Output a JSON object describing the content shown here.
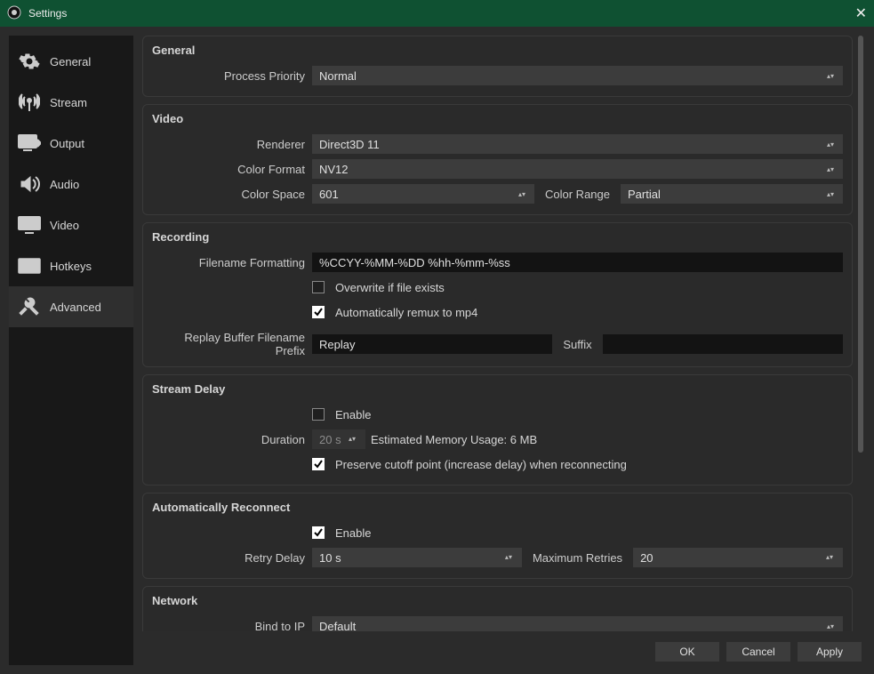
{
  "window": {
    "title": "Settings",
    "close": "✕"
  },
  "sidebar": {
    "items": [
      {
        "label": "General"
      },
      {
        "label": "Stream"
      },
      {
        "label": "Output"
      },
      {
        "label": "Audio"
      },
      {
        "label": "Video"
      },
      {
        "label": "Hotkeys"
      },
      {
        "label": "Advanced"
      }
    ]
  },
  "groups": {
    "general": {
      "title": "General",
      "process_priority_label": "Process Priority",
      "process_priority_value": "Normal"
    },
    "video": {
      "title": "Video",
      "renderer_label": "Renderer",
      "renderer_value": "Direct3D 11",
      "color_format_label": "Color Format",
      "color_format_value": "NV12",
      "color_space_label": "Color Space",
      "color_space_value": "601",
      "color_range_label": "Color Range",
      "color_range_value": "Partial"
    },
    "recording": {
      "title": "Recording",
      "filename_fmt_label": "Filename Formatting",
      "filename_fmt_value": "%CCYY-%MM-%DD %hh-%mm-%ss",
      "overwrite_label": "Overwrite if file exists",
      "overwrite_checked": false,
      "remux_label": "Automatically remux to mp4",
      "remux_checked": true,
      "replay_prefix_label": "Replay Buffer Filename Prefix",
      "replay_prefix_value": "Replay",
      "suffix_label": "Suffix",
      "suffix_value": ""
    },
    "stream_delay": {
      "title": "Stream Delay",
      "enable_label": "Enable",
      "enable_checked": false,
      "duration_label": "Duration",
      "duration_value": "20 s",
      "memory_usage": "Estimated Memory Usage: 6 MB",
      "preserve_label": "Preserve cutoff point (increase delay) when reconnecting",
      "preserve_checked": true
    },
    "reconnect": {
      "title": "Automatically Reconnect",
      "enable_label": "Enable",
      "enable_checked": true,
      "retry_delay_label": "Retry Delay",
      "retry_delay_value": "10 s",
      "max_retries_label": "Maximum Retries",
      "max_retries_value": "20"
    },
    "network": {
      "title": "Network",
      "bind_ip_label": "Bind to IP",
      "bind_ip_value": "Default"
    }
  },
  "footer": {
    "ok": "OK",
    "cancel": "Cancel",
    "apply": "Apply"
  }
}
